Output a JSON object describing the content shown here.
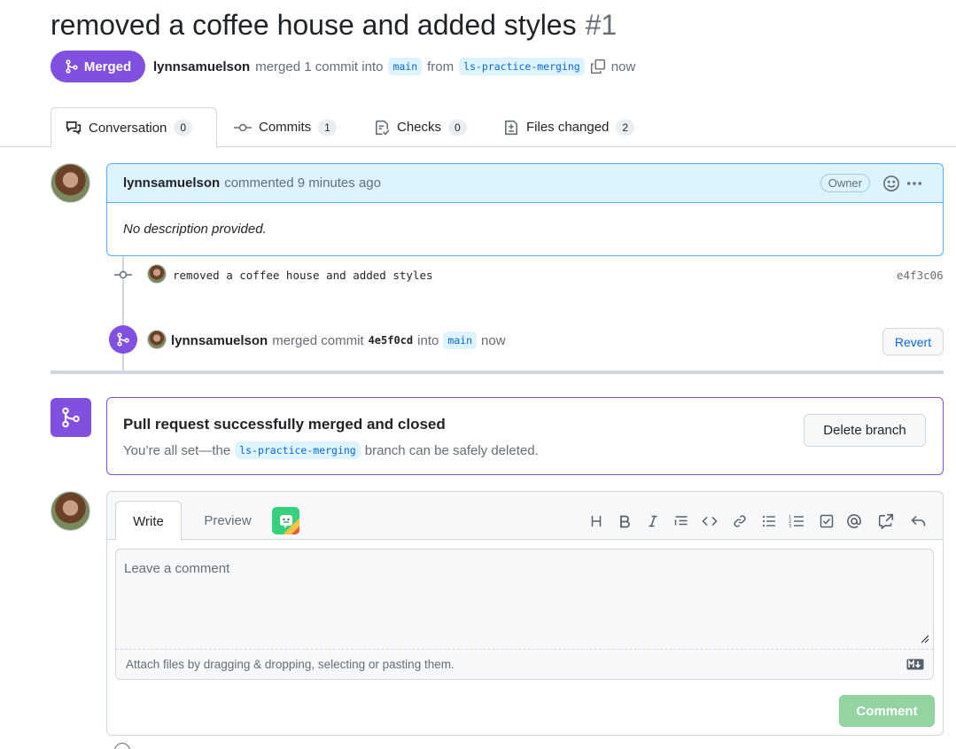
{
  "pr": {
    "title": "removed a coffee house and added styles",
    "number": "#1",
    "state": "Merged",
    "author": "lynnsamuelson",
    "merged_text": "merged 1 commit into",
    "base_branch": "main",
    "from_text": "from",
    "head_branch": "ls-practice-merging",
    "time": "now"
  },
  "tabs": [
    {
      "label": "Conversation",
      "count": "0",
      "icon": "comment-discussion-icon"
    },
    {
      "label": "Commits",
      "count": "1",
      "icon": "commit-icon"
    },
    {
      "label": "Checks",
      "count": "0",
      "icon": "checklist-icon"
    },
    {
      "label": "Files changed",
      "count": "2",
      "icon": "file-diff-icon"
    }
  ],
  "comment": {
    "author": "lynnsamuelson",
    "meta": "commented 9 minutes ago",
    "role": "Owner",
    "body": "No description provided."
  },
  "commit": {
    "message": "removed a coffee house and added styles",
    "sha": "e4f3c06"
  },
  "merge_event": {
    "author": "lynnsamuelson",
    "text": "merged commit",
    "sha": "4e5f0cd",
    "into": "into",
    "branch": "main",
    "time": "now",
    "revert_label": "Revert"
  },
  "merged_box": {
    "title": "Pull request successfully merged and closed",
    "text_before": "You’re all set—the",
    "branch": "ls-practice-merging",
    "text_after": "branch can be safely deleted.",
    "delete_label": "Delete branch"
  },
  "editor": {
    "write_tab": "Write",
    "preview_tab": "Preview",
    "placeholder": "Leave a comment",
    "attach_hint": "Attach files by dragging & dropping, selecting or pasting them.",
    "submit_label": "Comment",
    "toolbar": [
      "heading-icon",
      "bold-icon",
      "italic-icon",
      "quote-icon",
      "code-icon",
      "link-icon",
      "unordered-list-icon",
      "ordered-list-icon",
      "task-list-icon",
      "mention-icon",
      "cross-reference-icon",
      "reply-icon"
    ]
  },
  "colors": {
    "merged_purple": "#8250df",
    "accent_blue": "#0969da",
    "comment_header_bg": "#ddf4ff",
    "submit_disabled": "#94d3a2"
  }
}
